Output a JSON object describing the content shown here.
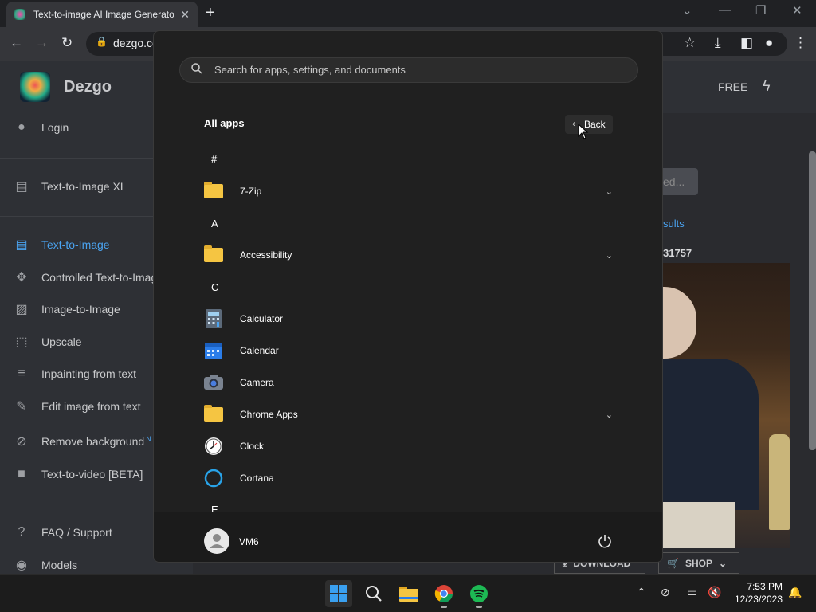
{
  "browser": {
    "tab_title": "Text-to-image AI Image Generator",
    "tab_close": "✕",
    "new_tab": "+",
    "url": "dezgo.co"
  },
  "site": {
    "brand": "Dezgo",
    "plan": "FREE",
    "sidebar": [
      {
        "label": "Login",
        "icon": "account-icon"
      },
      {
        "label": "Text-to-Image XL",
        "icon": "chat-icon"
      },
      {
        "label": "Text-to-Image",
        "icon": "chat-icon",
        "active": true
      },
      {
        "label": "Controlled Text-to-Imag",
        "icon": "move-icon"
      },
      {
        "label": "Image-to-Image",
        "icon": "image-icon"
      },
      {
        "label": "Upscale",
        "icon": "upscale-icon"
      },
      {
        "label": "Inpainting from text",
        "icon": "wrap-icon"
      },
      {
        "label": "Edit image from text",
        "icon": "edit-icon"
      },
      {
        "label": "Remove background",
        "icon": "hide-image-icon",
        "badge": "N"
      },
      {
        "label": "Text-to-video [BETA]",
        "icon": "video-icon"
      },
      {
        "label": "FAQ / Support",
        "icon": "help-icon"
      },
      {
        "label": "Models",
        "icon": "models-icon"
      }
    ],
    "generate_partial": "ed...",
    "results_partial": "sults",
    "seed_partial": "31757",
    "download_label": "DOWNLOAD",
    "shop_label": "SHOP"
  },
  "start_menu": {
    "search_placeholder": "Search for apps, settings, and documents",
    "title": "All apps",
    "back_label": "Back",
    "sections": [
      {
        "letter": "#",
        "apps": [
          {
            "name": "7-Zip",
            "icon": "folder-icon",
            "expandable": true
          }
        ]
      },
      {
        "letter": "A",
        "apps": [
          {
            "name": "Accessibility",
            "icon": "folder-icon",
            "expandable": true
          }
        ]
      },
      {
        "letter": "C",
        "apps": [
          {
            "name": "Calculator",
            "icon": "calculator-icon"
          },
          {
            "name": "Calendar",
            "icon": "calendar-icon"
          },
          {
            "name": "Camera",
            "icon": "camera-icon"
          },
          {
            "name": "Chrome Apps",
            "icon": "folder-icon",
            "expandable": true
          },
          {
            "name": "Clock",
            "icon": "clock-icon"
          },
          {
            "name": "Cortana",
            "icon": "cortana-icon"
          }
        ]
      },
      {
        "letter": "E",
        "apps": []
      }
    ],
    "user": "VM6"
  },
  "taskbar": {
    "time": "7:53 PM",
    "date": "12/23/2023",
    "pinned": [
      "start-icon",
      "search-icon",
      "file-explorer-icon",
      "chrome-icon",
      "spotify-icon"
    ]
  },
  "colors": {
    "accent": "#4aa3f0",
    "menu_bg": "#202020",
    "taskbar_bg": "#1c1c1c"
  }
}
